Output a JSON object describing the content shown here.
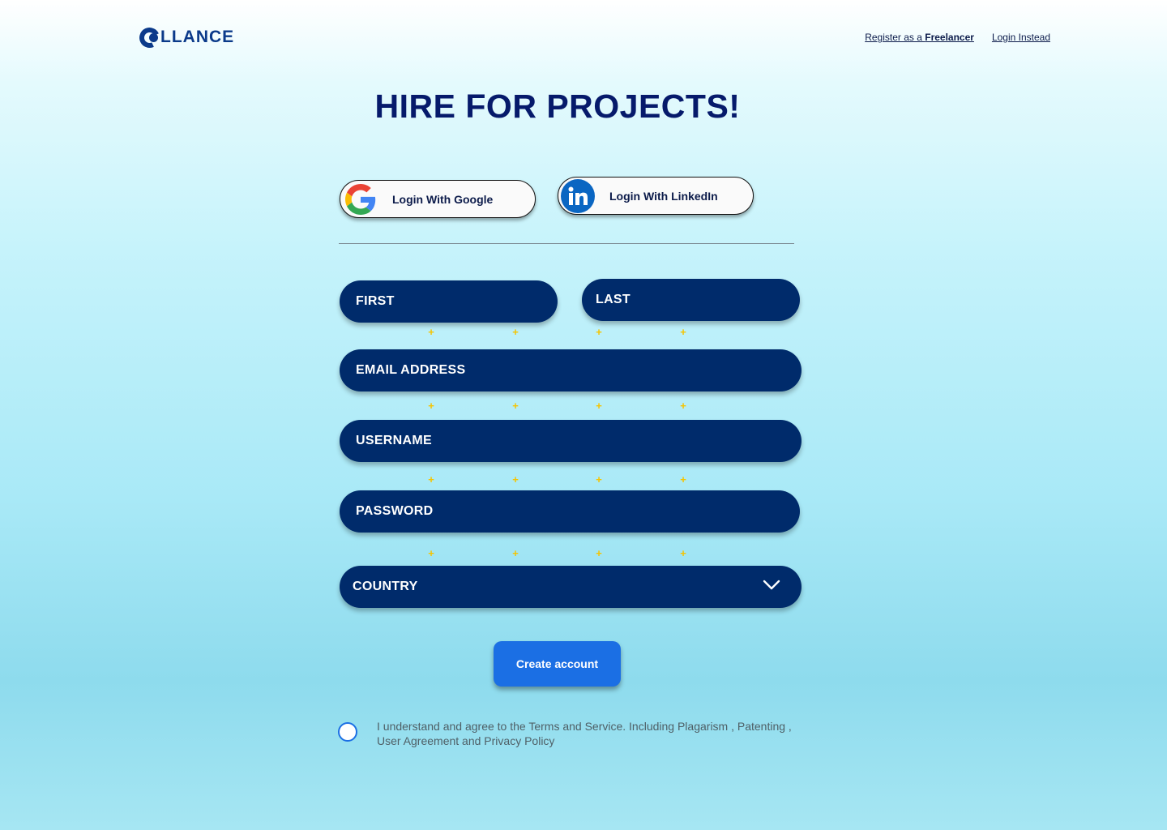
{
  "header": {
    "logo_text": "LLANCE",
    "logo_full": "COLLANCE",
    "register_prefix": "Register as a ",
    "register_bold": "Freelancer",
    "login_instead": "Login Instead"
  },
  "title": "HIRE FOR PROJECTS!",
  "social": {
    "google_label": "Login With Google",
    "linkedin_label": "Login With LinkedIn"
  },
  "form": {
    "first_placeholder": "FIRST",
    "last_placeholder": "LAST",
    "email_placeholder": "EMAIL ADDRESS",
    "username_placeholder": "USERNAME",
    "password_placeholder": "PASSWORD",
    "country_label": "COUNTRY"
  },
  "create_button": "Create account",
  "terms_text": "I understand and agree to the Terms and Service. Including Plagarism , Patenting , User Agreement and Privacy Policy",
  "colors": {
    "field_bg": "#002b6b",
    "button_bg": "#1b6fe4",
    "title": "#061a6b",
    "sparkle": "#f5c400"
  }
}
